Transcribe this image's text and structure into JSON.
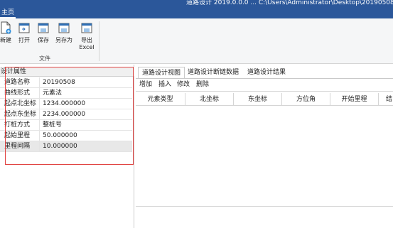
{
  "window": {
    "title": "道路设计 2019.0.0.0 ... C:\\Users\\Administrator\\Desktop\\20190508.dr"
  },
  "ribbon": {
    "tabs": [
      {
        "label": "主页"
      }
    ],
    "buttons": [
      {
        "label": "新建",
        "icon": "new-file-icon"
      },
      {
        "label": "打开",
        "icon": "open-folder-icon"
      },
      {
        "label": "保存",
        "icon": "save-icon"
      },
      {
        "label": "另存为",
        "icon": "save-as-icon"
      },
      {
        "label": "导出\nExcel",
        "icon": "export-excel-icon"
      }
    ],
    "group_label": "文件"
  },
  "properties": {
    "header": "设计属性",
    "rows": [
      {
        "key": "道路名称",
        "value": "20190508"
      },
      {
        "key": "曲线形式",
        "value": "元素法"
      },
      {
        "key": "起点北坐标",
        "value": "1234.000000"
      },
      {
        "key": "起点东坐标",
        "value": "2234.000000"
      },
      {
        "key": "打桩方式",
        "value": "整桩号"
      },
      {
        "key": "起始里程",
        "value": "50.000000"
      },
      {
        "key": "里程间隔",
        "value": "10.000000"
      }
    ]
  },
  "document_tabs": [
    {
      "label": "道路设计视图",
      "active": true
    },
    {
      "label": "道路设计断链数据",
      "active": false
    },
    {
      "label": "道路设计结果",
      "active": false
    }
  ],
  "toolbar": {
    "add": "增加",
    "insert": "插入",
    "edit": "修改",
    "delete": "删除"
  },
  "grid": {
    "columns": [
      "元素类型",
      "北坐标",
      "东坐标",
      "方位角",
      "开始里程",
      "结"
    ]
  },
  "colors": {
    "ribbon_blue": "#2b579a",
    "highlight_red": "#e0413f"
  }
}
